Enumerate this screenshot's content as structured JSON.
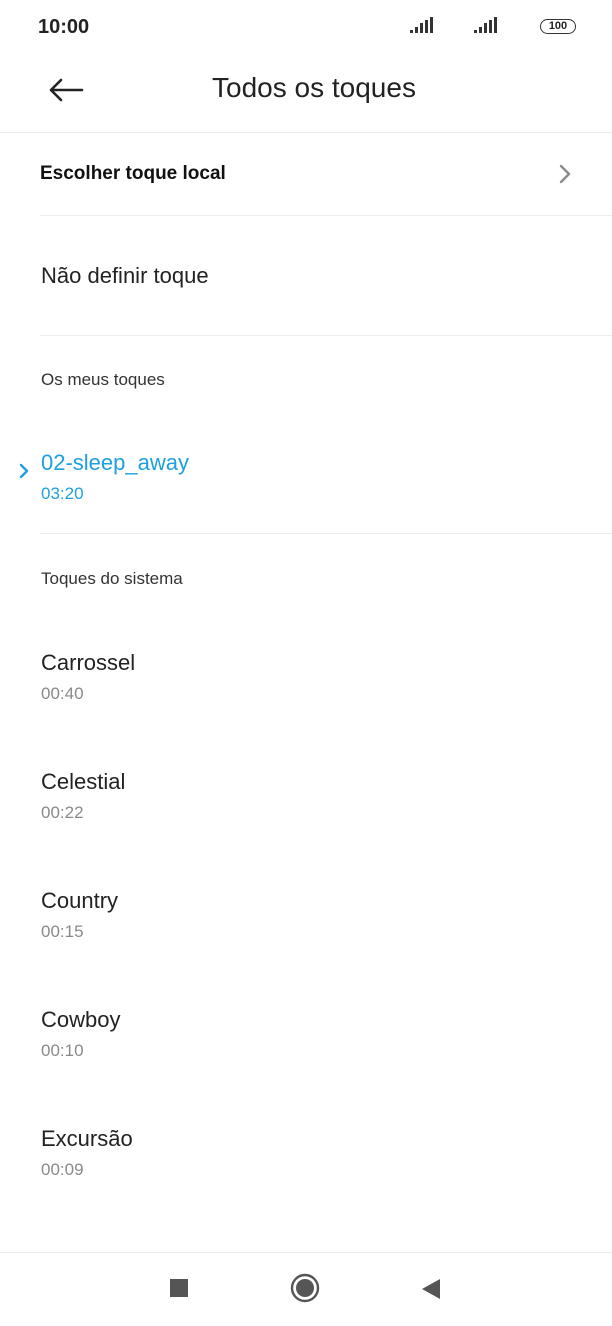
{
  "status_bar": {
    "time": "10:00",
    "battery": "100",
    "icons": [
      "signal-icon",
      "signal-icon",
      "battery-icon"
    ]
  },
  "header": {
    "title": "Todos os toques",
    "back_icon": "arrow-left-icon"
  },
  "options": {
    "choose_local": "Escolher toque local",
    "no_ringtone": "Não definir toque"
  },
  "my_ringtones": {
    "section_label": "Os meus toques",
    "items": [
      {
        "name": "02-sleep_away",
        "duration": "03:20",
        "selected": true
      }
    ]
  },
  "system_ringtones": {
    "section_label": "Toques do sistema",
    "items": [
      {
        "name": "Carrossel",
        "duration": "00:40"
      },
      {
        "name": "Celestial",
        "duration": "00:22"
      },
      {
        "name": "Country",
        "duration": "00:15"
      },
      {
        "name": "Cowboy",
        "duration": "00:10"
      },
      {
        "name": "Excursão",
        "duration": "00:09"
      }
    ]
  },
  "colors": {
    "accent": "#1ea0df",
    "secondary_text": "#8a8a8a",
    "divider": "#ececec"
  },
  "nav_bar": {
    "icons": [
      "recents-square-icon",
      "home-circle-icon",
      "back-triangle-icon"
    ]
  }
}
